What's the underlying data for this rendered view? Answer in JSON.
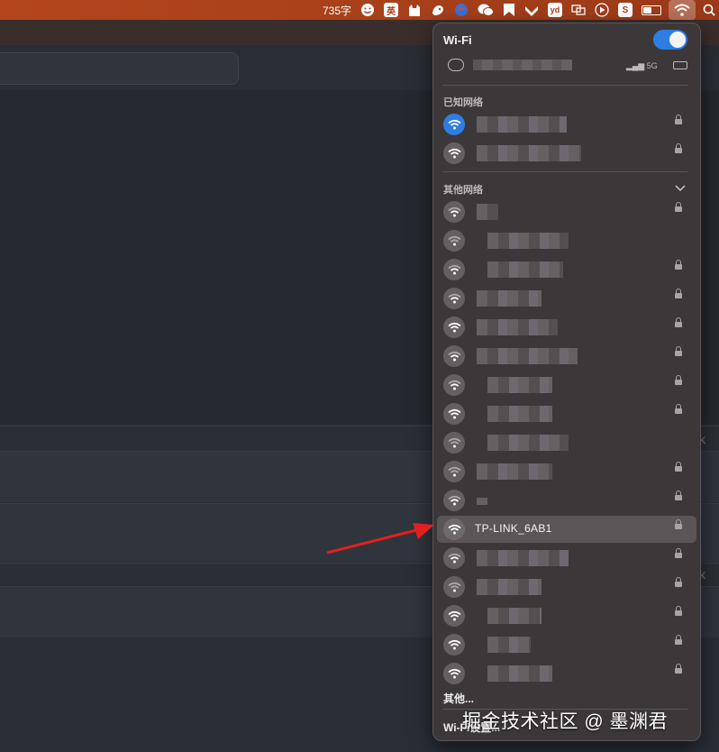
{
  "menubar": {
    "word_count": "735字",
    "input_method": "英",
    "icons": [
      "smiley-icon",
      "input-method-icon",
      "cat-app-icon",
      "bird-app-icon",
      "browser-app-icon",
      "wechat-icon",
      "bookmark-app-icon",
      "image-app-icon",
      "youdao-icon",
      "screen-mirror-icon",
      "play-icon",
      "sogou-icon",
      "battery-icon",
      "wifi-icon",
      "search-icon"
    ]
  },
  "wifi_menu": {
    "title": "Wi-Fi",
    "enabled": true,
    "current_signal": "5G",
    "known_section": "已知网络",
    "other_section": "其他网络",
    "highlight_network": "TP-LINK_6AB1",
    "other_link": "其他...",
    "settings_link": "Wi-Fi设置..."
  },
  "watermark": "掘金技术社区 @ 墨渊君",
  "colors": {
    "accent": "#2f7de0",
    "arrow": "#e02020",
    "menubar": "#a63f1a"
  }
}
